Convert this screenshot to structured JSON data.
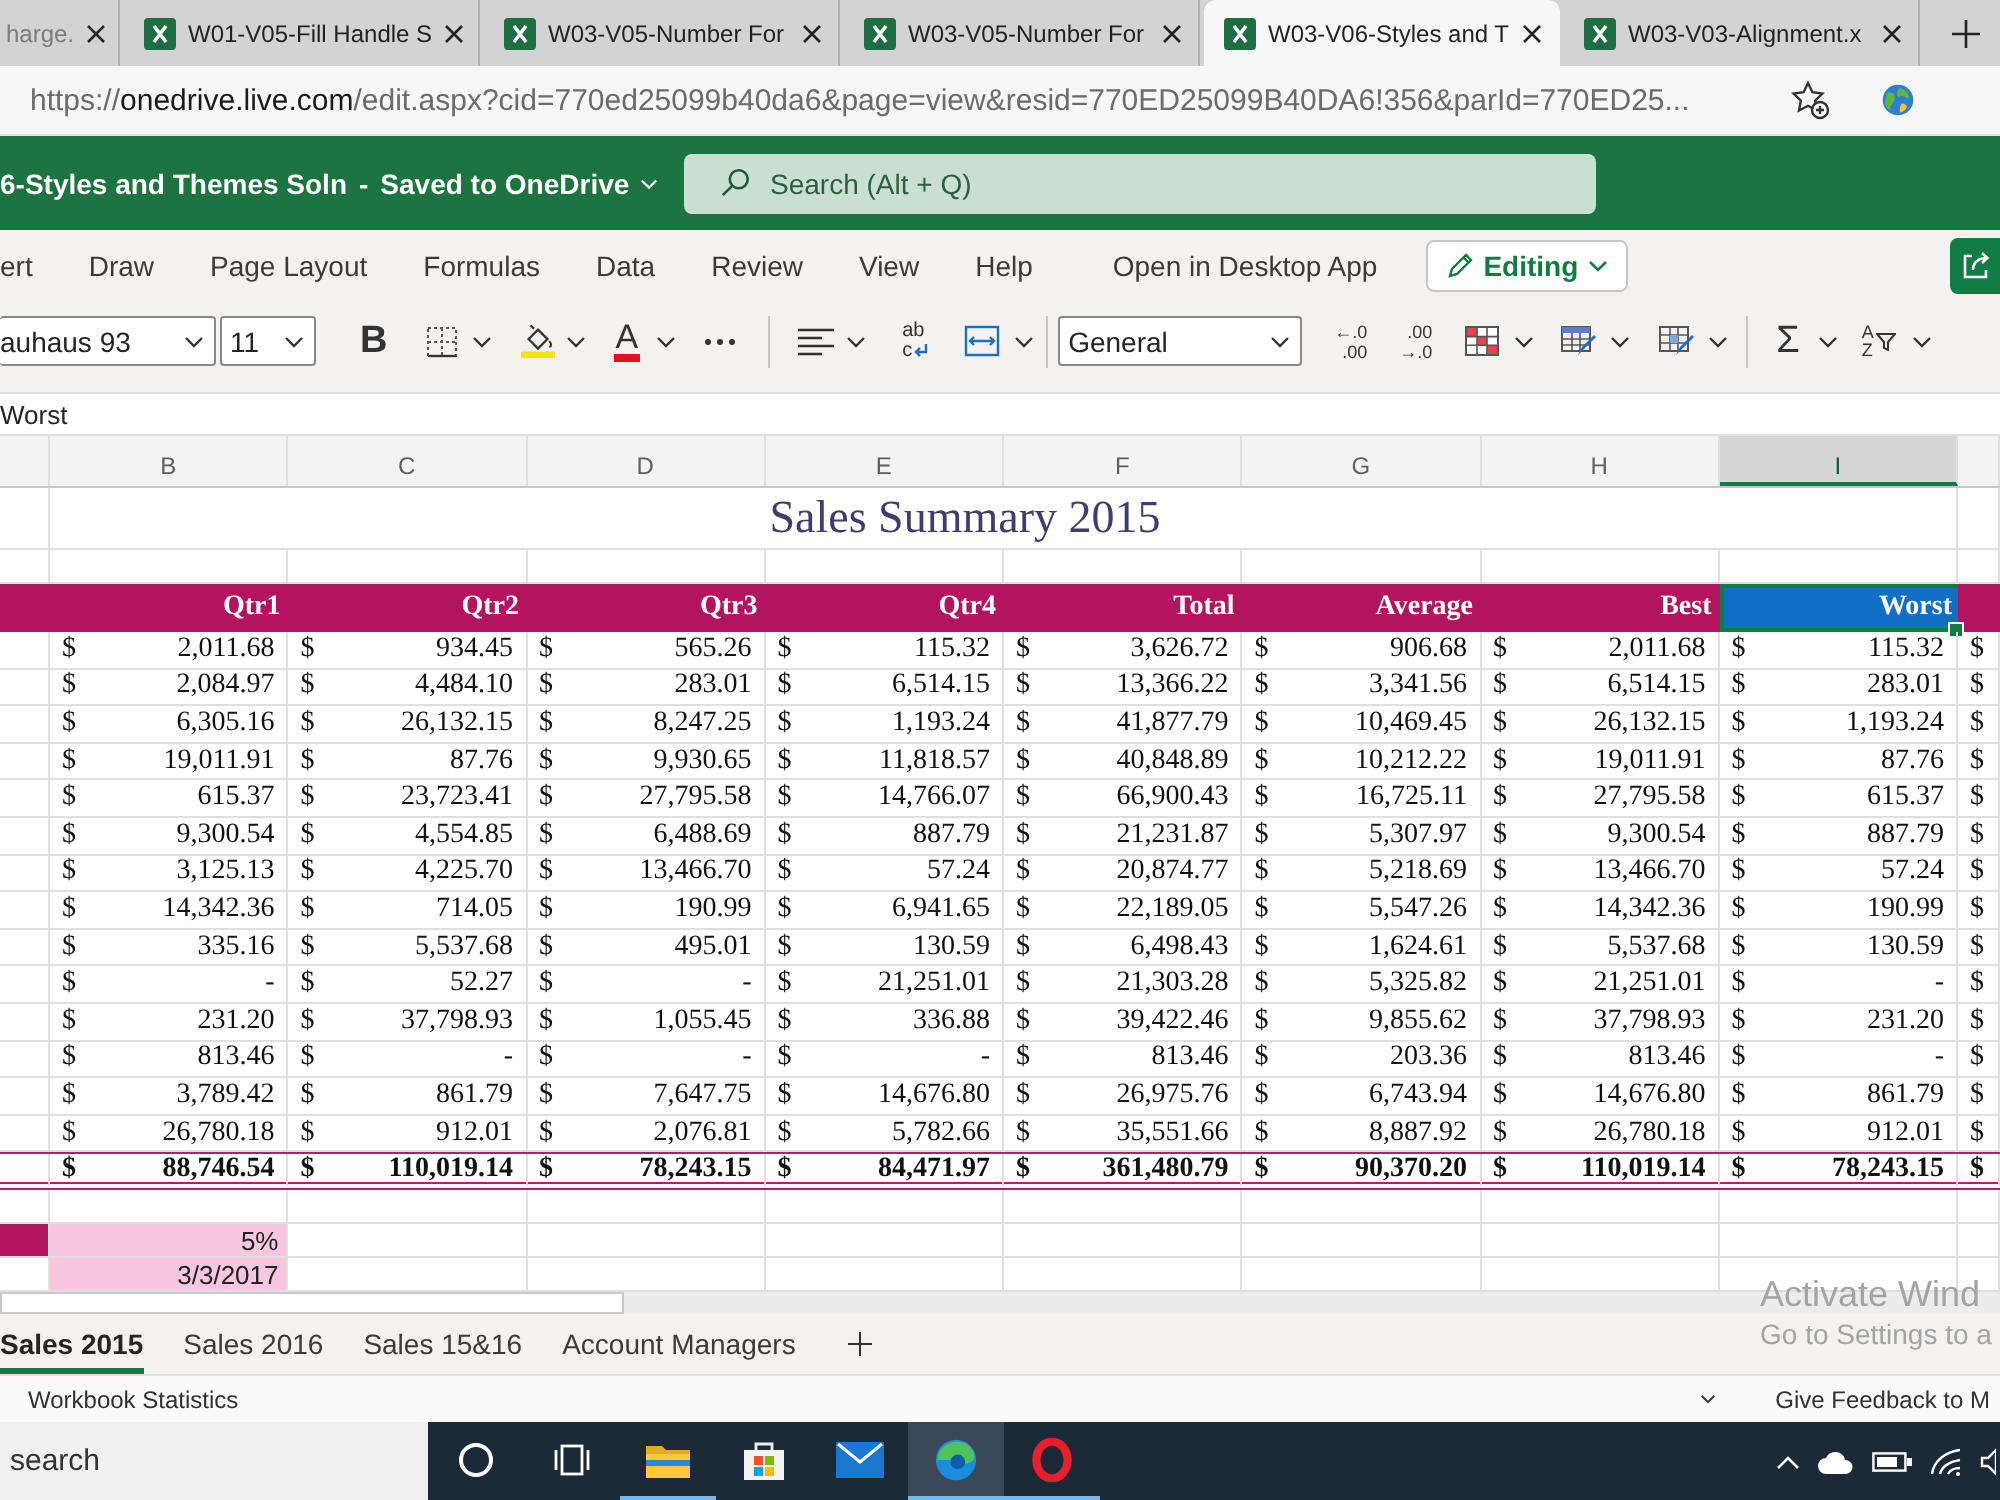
{
  "browser": {
    "tabs": [
      {
        "title": "harge.",
        "selected": false
      },
      {
        "title": "W01-V05-Fill Handle S",
        "selected": false
      },
      {
        "title": "W03-V05-Number For",
        "selected": false
      },
      {
        "title": "W03-V05-Number For",
        "selected": false
      },
      {
        "title": "W03-V06-Styles and T",
        "selected": true
      },
      {
        "title": "W03-V03-Alignment.x",
        "selected": false
      }
    ],
    "address": {
      "scheme": "https://",
      "host": "onedrive.live.com",
      "path": "/edit.aspx?cid=770ed25099b40da6&page=view&resid=770ED25099B40DA6!356&parId=770ED25..."
    }
  },
  "app_bar": {
    "title": "6-Styles and Themes Soln",
    "separator": "-",
    "status": "Saved to OneDrive",
    "search": {
      "placeholder": "Search (Alt + Q)"
    }
  },
  "ribbon": {
    "tabs": [
      {
        "label": "ert",
        "selected": false
      },
      {
        "label": "Draw",
        "selected": false
      },
      {
        "label": "Page Layout",
        "selected": false
      },
      {
        "label": "Formulas",
        "selected": false
      },
      {
        "label": "Data",
        "selected": false
      },
      {
        "label": "Review",
        "selected": false
      },
      {
        "label": "View",
        "selected": false
      },
      {
        "label": "Help",
        "selected": false
      }
    ],
    "open_desktop": "Open in Desktop App",
    "mode": "Editing"
  },
  "toolbar": {
    "font": "auhaus 93",
    "size": "11",
    "bold": "B",
    "font_color": "A",
    "wrap": [
      "ab",
      "c"
    ],
    "number_format": "General",
    "decrease_decimal": [
      "←.0",
      ".00"
    ],
    "increase_decimal": [
      ".00",
      "→.0"
    ],
    "sum": "Σ",
    "sort": [
      "A",
      "Z"
    ]
  },
  "formula_bar": {
    "value": "Worst"
  },
  "sheet": {
    "columns": [
      {
        "label": "B",
        "selected": false
      },
      {
        "label": "C",
        "selected": false
      },
      {
        "label": "D",
        "selected": false
      },
      {
        "label": "E",
        "selected": false
      },
      {
        "label": "F",
        "selected": false
      },
      {
        "label": "G",
        "selected": false
      },
      {
        "label": "H",
        "selected": false
      },
      {
        "label": "I",
        "selected": true
      }
    ],
    "title": "Sales Summary 2015",
    "headers": [
      {
        "label": "Qtr1",
        "selected": false
      },
      {
        "label": "Qtr2",
        "selected": false
      },
      {
        "label": "Qtr3",
        "selected": false
      },
      {
        "label": "Qtr4",
        "selected": false
      },
      {
        "label": "Total",
        "selected": false
      },
      {
        "label": "Average",
        "selected": false
      },
      {
        "label": "Best",
        "selected": false
      },
      {
        "label": "Worst",
        "selected": true
      }
    ],
    "rows": [
      [
        [
          "$",
          "2,011.68"
        ],
        [
          "$",
          "934.45"
        ],
        [
          "$",
          "565.26"
        ],
        [
          "$",
          "115.32"
        ],
        [
          "$",
          "3,626.72"
        ],
        [
          "$",
          "906.68"
        ],
        [
          "$",
          "2,011.68"
        ],
        [
          "$",
          "115.32"
        ],
        [
          "$"
        ]
      ],
      [
        [
          "$",
          "2,084.97"
        ],
        [
          "$",
          "4,484.10"
        ],
        [
          "$",
          "283.01"
        ],
        [
          "$",
          "6,514.15"
        ],
        [
          "$",
          "13,366.22"
        ],
        [
          "$",
          "3,341.56"
        ],
        [
          "$",
          "6,514.15"
        ],
        [
          "$",
          "283.01"
        ],
        [
          "$"
        ]
      ],
      [
        [
          "$",
          "6,305.16"
        ],
        [
          "$",
          "26,132.15"
        ],
        [
          "$",
          "8,247.25"
        ],
        [
          "$",
          "1,193.24"
        ],
        [
          "$",
          "41,877.79"
        ],
        [
          "$",
          "10,469.45"
        ],
        [
          "$",
          "26,132.15"
        ],
        [
          "$",
          "1,193.24"
        ],
        [
          "$"
        ]
      ],
      [
        [
          "$",
          "19,011.91"
        ],
        [
          "$",
          "87.76"
        ],
        [
          "$",
          "9,930.65"
        ],
        [
          "$",
          "11,818.57"
        ],
        [
          "$",
          "40,848.89"
        ],
        [
          "$",
          "10,212.22"
        ],
        [
          "$",
          "19,011.91"
        ],
        [
          "$",
          "87.76"
        ],
        [
          "$"
        ]
      ],
      [
        [
          "$",
          "615.37"
        ],
        [
          "$",
          "23,723.41"
        ],
        [
          "$",
          "27,795.58"
        ],
        [
          "$",
          "14,766.07"
        ],
        [
          "$",
          "66,900.43"
        ],
        [
          "$",
          "16,725.11"
        ],
        [
          "$",
          "27,795.58"
        ],
        [
          "$",
          "615.37"
        ],
        [
          "$"
        ]
      ],
      [
        [
          "$",
          "9,300.54"
        ],
        [
          "$",
          "4,554.85"
        ],
        [
          "$",
          "6,488.69"
        ],
        [
          "$",
          "887.79"
        ],
        [
          "$",
          "21,231.87"
        ],
        [
          "$",
          "5,307.97"
        ],
        [
          "$",
          "9,300.54"
        ],
        [
          "$",
          "887.79"
        ],
        [
          "$"
        ]
      ],
      [
        [
          "$",
          "3,125.13"
        ],
        [
          "$",
          "4,225.70"
        ],
        [
          "$",
          "13,466.70"
        ],
        [
          "$",
          "57.24"
        ],
        [
          "$",
          "20,874.77"
        ],
        [
          "$",
          "5,218.69"
        ],
        [
          "$",
          "13,466.70"
        ],
        [
          "$",
          "57.24"
        ],
        [
          "$"
        ]
      ],
      [
        [
          "$",
          "14,342.36"
        ],
        [
          "$",
          "714.05"
        ],
        [
          "$",
          "190.99"
        ],
        [
          "$",
          "6,941.65"
        ],
        [
          "$",
          "22,189.05"
        ],
        [
          "$",
          "5,547.26"
        ],
        [
          "$",
          "14,342.36"
        ],
        [
          "$",
          "190.99"
        ],
        [
          "$"
        ]
      ],
      [
        [
          "$",
          "335.16"
        ],
        [
          "$",
          "5,537.68"
        ],
        [
          "$",
          "495.01"
        ],
        [
          "$",
          "130.59"
        ],
        [
          "$",
          "6,498.43"
        ],
        [
          "$",
          "1,624.61"
        ],
        [
          "$",
          "5,537.68"
        ],
        [
          "$",
          "130.59"
        ],
        [
          "$"
        ]
      ],
      [
        [
          "$",
          "-"
        ],
        [
          "$",
          "52.27"
        ],
        [
          "$",
          "-"
        ],
        [
          "$",
          "21,251.01"
        ],
        [
          "$",
          "21,303.28"
        ],
        [
          "$",
          "5,325.82"
        ],
        [
          "$",
          "21,251.01"
        ],
        [
          "$",
          "-"
        ],
        [
          "$"
        ]
      ],
      [
        [
          "$",
          "231.20"
        ],
        [
          "$",
          "37,798.93"
        ],
        [
          "$",
          "1,055.45"
        ],
        [
          "$",
          "336.88"
        ],
        [
          "$",
          "39,422.46"
        ],
        [
          "$",
          "9,855.62"
        ],
        [
          "$",
          "37,798.93"
        ],
        [
          "$",
          "231.20"
        ],
        [
          "$"
        ]
      ],
      [
        [
          "$",
          "813.46"
        ],
        [
          "$",
          "-"
        ],
        [
          "$",
          "-"
        ],
        [
          "$",
          "-"
        ],
        [
          "$",
          "813.46"
        ],
        [
          "$",
          "203.36"
        ],
        [
          "$",
          "813.46"
        ],
        [
          "$",
          "-"
        ],
        [
          "$"
        ]
      ],
      [
        [
          "$",
          "3,789.42"
        ],
        [
          "$",
          "861.79"
        ],
        [
          "$",
          "7,647.75"
        ],
        [
          "$",
          "14,676.80"
        ],
        [
          "$",
          "26,975.76"
        ],
        [
          "$",
          "6,743.94"
        ],
        [
          "$",
          "14,676.80"
        ],
        [
          "$",
          "861.79"
        ],
        [
          "$"
        ]
      ],
      [
        [
          "$",
          "26,780.18"
        ],
        [
          "$",
          "912.01"
        ],
        [
          "$",
          "2,076.81"
        ],
        [
          "$",
          "5,782.66"
        ],
        [
          "$",
          "35,551.66"
        ],
        [
          "$",
          "8,887.92"
        ],
        [
          "$",
          "26,780.18"
        ],
        [
          "$",
          "912.01"
        ],
        [
          "$"
        ]
      ]
    ],
    "total": [
      [
        "$",
        "88,746.54"
      ],
      [
        "$",
        "110,019.14"
      ],
      [
        "$",
        "78,243.15"
      ],
      [
        "$",
        "84,471.97"
      ],
      [
        "$",
        "361,480.79"
      ],
      [
        "$",
        "90,370.20"
      ],
      [
        "$",
        "110,019.14"
      ],
      [
        "$",
        "78,243.15"
      ],
      [
        "$"
      ]
    ],
    "notes": [
      {
        "value": "5%",
        "accent": true
      },
      {
        "value": "3/3/2017",
        "accent": false
      }
    ]
  },
  "sheet_tabs": [
    {
      "label": "Sales 2015",
      "selected": true
    },
    {
      "label": "Sales 2016",
      "selected": false
    },
    {
      "label": "Sales 15&16",
      "selected": false
    },
    {
      "label": "Account Managers",
      "selected": false
    }
  ],
  "status_bar": {
    "left": "Workbook Statistics",
    "right": "Give Feedback to M"
  },
  "os_notice": {
    "title": "Activate Wind",
    "text": "Go to Settings to a"
  },
  "taskbar": {
    "search": {
      "placeholder": "search"
    },
    "apps": [
      {
        "kind": "circle",
        "running": false,
        "selected": false
      },
      {
        "kind": "task_view",
        "running": false,
        "selected": false
      },
      {
        "kind": "folder",
        "running": true,
        "selected": false
      },
      {
        "kind": "store",
        "running": false,
        "selected": false
      },
      {
        "kind": "mail",
        "running": false,
        "selected": false
      },
      {
        "kind": "browser",
        "running": true,
        "selected": true
      },
      {
        "kind": "ring",
        "running": true,
        "selected": false
      }
    ]
  }
}
